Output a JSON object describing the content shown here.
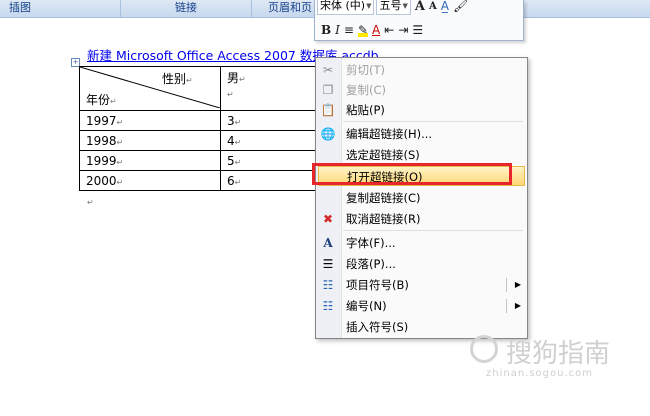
{
  "ribbon": {
    "tabs": [
      "插图",
      "链接",
      "页眉和页"
    ]
  },
  "mini_toolbar": {
    "font_name": "宋体 (中)",
    "font_size": "五号",
    "grow_label": "A",
    "shrink_label": "A",
    "bold": "B",
    "italic": "I",
    "align": "≡",
    "font_color_label": "A"
  },
  "document": {
    "hyperlink_text": "新建  Microsoft Office Access 2007  数据库.accdb",
    "table": {
      "header_right": "性别",
      "header_left": "年份",
      "header_value": "男",
      "rows": [
        {
          "year": "1997",
          "value": "3"
        },
        {
          "year": "1998",
          "value": "4"
        },
        {
          "year": "1999",
          "value": "5"
        },
        {
          "year": "2000",
          "value": "6"
        }
      ]
    }
  },
  "context_menu": {
    "items": [
      {
        "label": "剪切(T)",
        "icon": "scissors-icon",
        "disabled": true
      },
      {
        "label": "复制(C)",
        "icon": "copy-icon",
        "disabled": true
      },
      {
        "label": "粘贴(P)",
        "icon": "paste-icon",
        "disabled": false
      },
      {
        "label": "编辑超链接(H)...",
        "icon": "edit-hyperlink-icon",
        "disabled": false
      },
      {
        "label": "选定超链接(S)",
        "icon": "",
        "disabled": false
      },
      {
        "label": "打开超链接(O)",
        "icon": "",
        "disabled": false,
        "highlighted": true
      },
      {
        "label": "复制超链接(C)",
        "icon": "",
        "disabled": false
      },
      {
        "label": "取消超链接(R)",
        "icon": "remove-hyperlink-icon",
        "disabled": false
      },
      {
        "label": "字体(F)...",
        "icon": "font-icon",
        "disabled": false
      },
      {
        "label": "段落(P)...",
        "icon": "paragraph-icon",
        "disabled": false
      },
      {
        "label": "项目符号(B)",
        "icon": "bullets-icon",
        "disabled": false,
        "submenu": true
      },
      {
        "label": "编号(N)",
        "icon": "numbering-icon",
        "disabled": false,
        "submenu": true
      },
      {
        "label": "插入符号(S)",
        "icon": "",
        "disabled": false
      }
    ]
  },
  "watermark": {
    "text": "搜狗指南",
    "url": "zhinan.sogou.com"
  },
  "colors": {
    "highlight_border": "#e6262a",
    "hyperlink": "#0000ee",
    "menu_hover": "#ffd775"
  }
}
